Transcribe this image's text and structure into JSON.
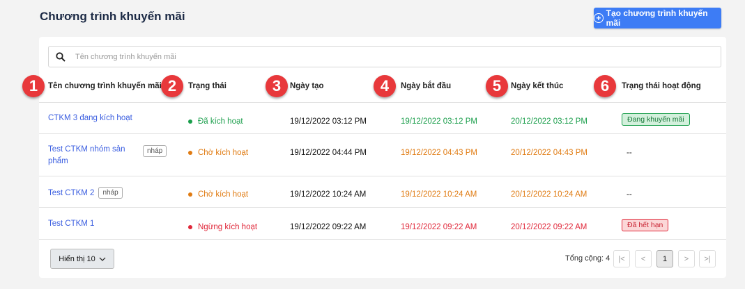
{
  "page": {
    "title": "Chương trình khuyến mãi",
    "create_button": "Tạo chương trình khuyến mãi"
  },
  "search": {
    "placeholder": "Tên chương trình khuyến mãi",
    "value": ""
  },
  "columns": [
    "Tên chương trình khuyến mãi",
    "Trạng thái",
    "Ngày tạo",
    "Ngày bắt đầu",
    "Ngày kết thúc",
    "Trạng thái hoạt động"
  ],
  "markers": [
    "1",
    "2",
    "3",
    "4",
    "5",
    "6"
  ],
  "rows": [
    {
      "name": "CTKM 3 đang kích hoạt",
      "draft": "",
      "status": "Đã kích hoạt",
      "status_color": "#1a9e4b",
      "created": "19/12/2022 03:12 PM",
      "start": "19/12/2022 03:12 PM",
      "end": "20/12/2022 03:12 PM",
      "date_color": "#1a9e4b",
      "active_state": "Đang khuyến mãi",
      "active_state_style": "green"
    },
    {
      "name": "Test CTKM nhóm sản phẩm",
      "draft": "nháp",
      "status": "Chờ kích hoạt",
      "status_color": "#e07b12",
      "created": "19/12/2022 04:44 PM",
      "start": "19/12/2022 04:43 PM",
      "end": "20/12/2022 04:43 PM",
      "date_color": "#e07b12",
      "active_state": "--",
      "active_state_style": "none"
    },
    {
      "name": "Test CTKM 2",
      "draft": "nháp",
      "status": "Chờ kích hoạt",
      "status_color": "#e07b12",
      "created": "19/12/2022 10:24 AM",
      "start": "19/12/2022 10:24 AM",
      "end": "20/12/2022 10:24 AM",
      "date_color": "#e07b12",
      "active_state": "--",
      "active_state_style": "none"
    },
    {
      "name": "Test CTKM 1",
      "draft": "",
      "status": "Ngừng kích hoạt",
      "status_color": "#e0283a",
      "created": "19/12/2022 09:22 AM",
      "start": "19/12/2022 09:22 AM",
      "end": "20/12/2022 09:22 AM",
      "date_color": "#e0283a",
      "active_state": "Đã hết hạn",
      "active_state_style": "red"
    }
  ],
  "footer": {
    "page_size": "Hiển thị 10",
    "total": "Tổng cộng: 4",
    "current_page": "1"
  }
}
